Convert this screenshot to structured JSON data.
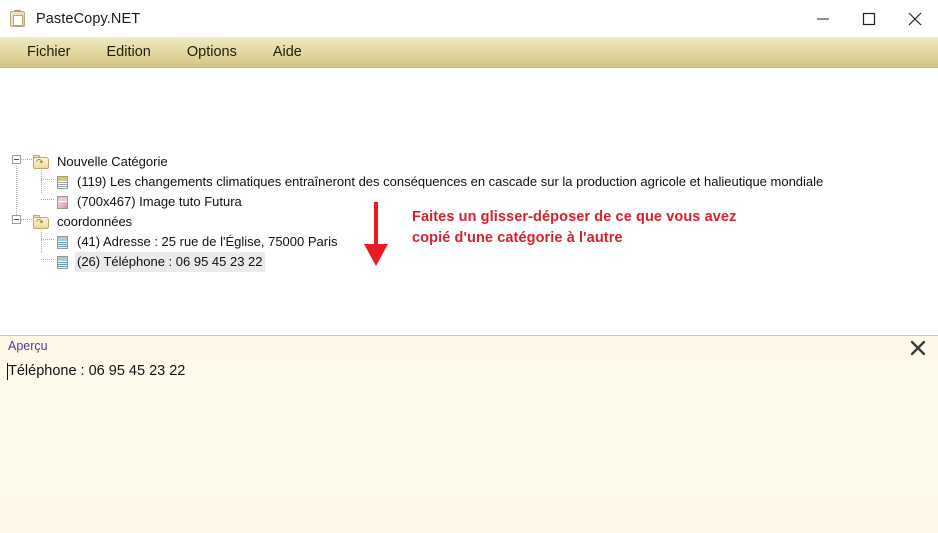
{
  "window": {
    "title": "PasteCopy.NET",
    "icon": "clipboard-icon",
    "controls": {
      "minimize": "minimize-icon",
      "maximize": "maximize-icon",
      "close": "close-icon"
    }
  },
  "menubar": {
    "items": [
      {
        "label": "Fichier"
      },
      {
        "label": "Edition"
      },
      {
        "label": "Options"
      },
      {
        "label": "Aide"
      }
    ]
  },
  "tree": {
    "nodes": [
      {
        "label": "Nouvelle Catégorie",
        "icon": "folder-icon",
        "expanded": true,
        "children": [
          {
            "label": "(119) Les changements climatiques entraîneront des conséquences en cascade sur la production agricole et halieutique mondiale",
            "icon": "text-document-icon",
            "selected": false
          },
          {
            "label": "(700x467) Image tuto Futura",
            "icon": "image-document-icon",
            "selected": false
          }
        ]
      },
      {
        "label": "coordonnées",
        "icon": "folder-icon",
        "expanded": true,
        "children": [
          {
            "label": "(41) Adresse : 25 rue de l'Église, 75000 Paris",
            "icon": "text-snippet-icon",
            "selected": false
          },
          {
            "label": "(26) Téléphone : 06 95 45 23 22",
            "icon": "text-snippet-icon",
            "selected": true
          }
        ]
      }
    ]
  },
  "annotation": {
    "text": "Faites un glisser-déposer de ce que vous avez copié d'une catégorie à l'autre",
    "color": "#d81f2a",
    "arrow": "down-arrow-icon"
  },
  "preview": {
    "label": "Aperçu",
    "close_icon": "close-preview-icon",
    "content": "Téléphone : 06 95 45 23 22"
  },
  "colors": {
    "menubar_gold": "#ddd094",
    "preview_cream": "#fdf8e7",
    "annotation_red": "#d81f2a",
    "preview_label_purple": "#4b3f8c",
    "selection_gray": "#eaeaea"
  }
}
